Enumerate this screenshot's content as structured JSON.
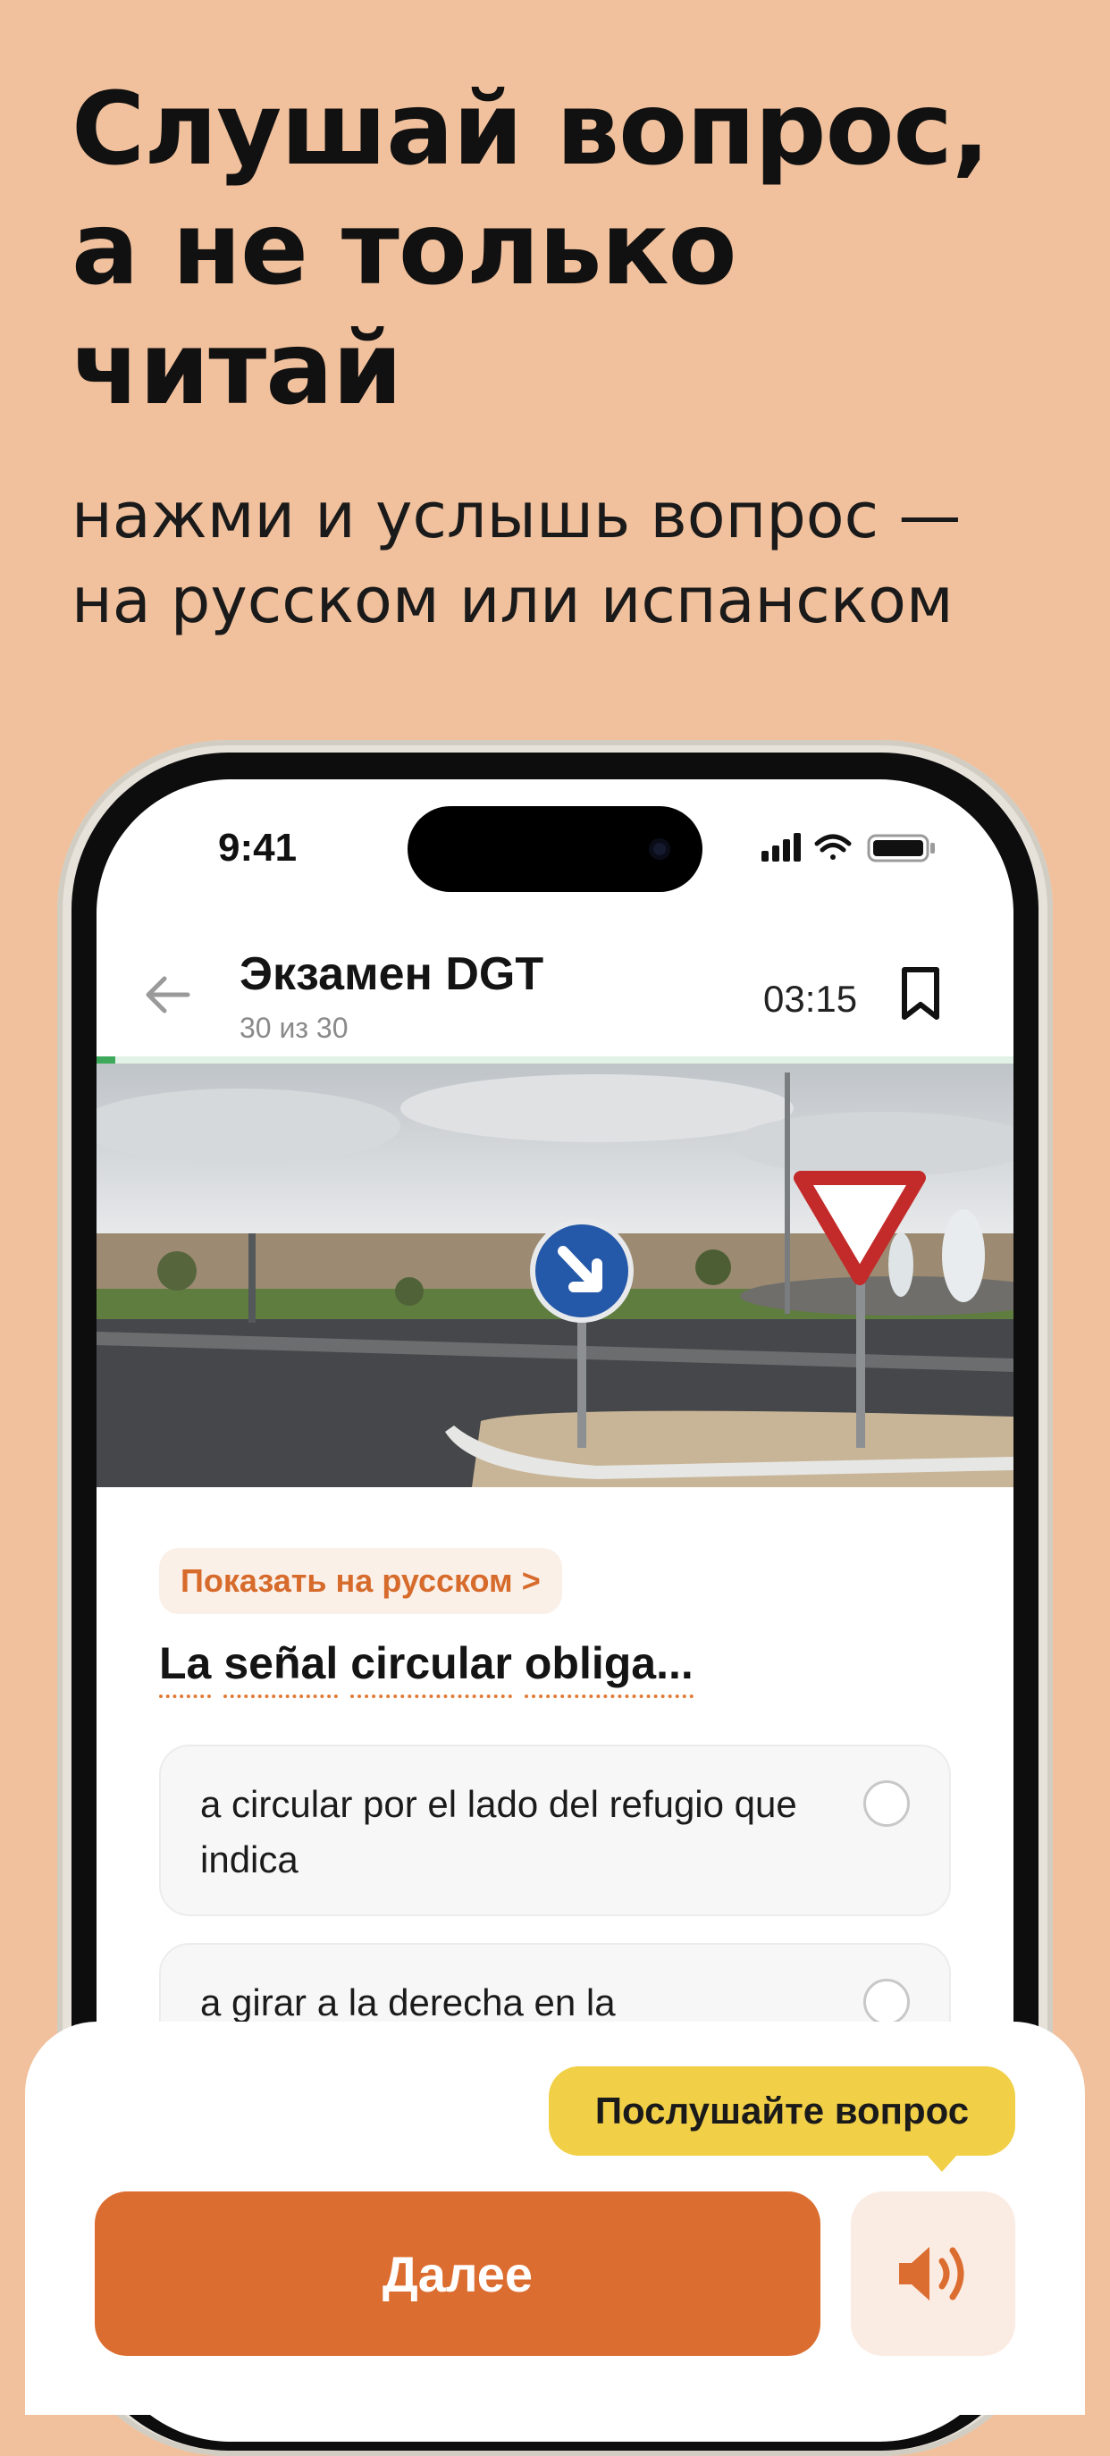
{
  "promo": {
    "headline": [
      "Слушай вопрос,",
      "а не только",
      "читай"
    ],
    "subline": [
      "нажми и услышь вопрос —",
      "на русском или испанском"
    ]
  },
  "status_bar": {
    "time": "9:41"
  },
  "header": {
    "title": "Экзамен DGT",
    "subtitle": "30 из 30",
    "timer": "03:15",
    "progress": 0.02
  },
  "question": {
    "translate_label": "Показать на русском >",
    "words": [
      "La",
      "señal",
      "circular",
      "obliga..."
    ],
    "answers": [
      "a circular por el lado del refugio que indica",
      "a girar a la derecha en la"
    ]
  },
  "bottom_bar": {
    "next_label": "Далее",
    "tooltip": "Послушайте вопрос"
  },
  "icons": {
    "back": "arrow-left-icon",
    "bookmark": "bookmark-icon",
    "audio": "speaker-icon"
  },
  "colors": {
    "background": "#f1c09c",
    "accent": "#dc6d30",
    "tooltip": "#f1d048",
    "progress": "#3ea95a"
  }
}
